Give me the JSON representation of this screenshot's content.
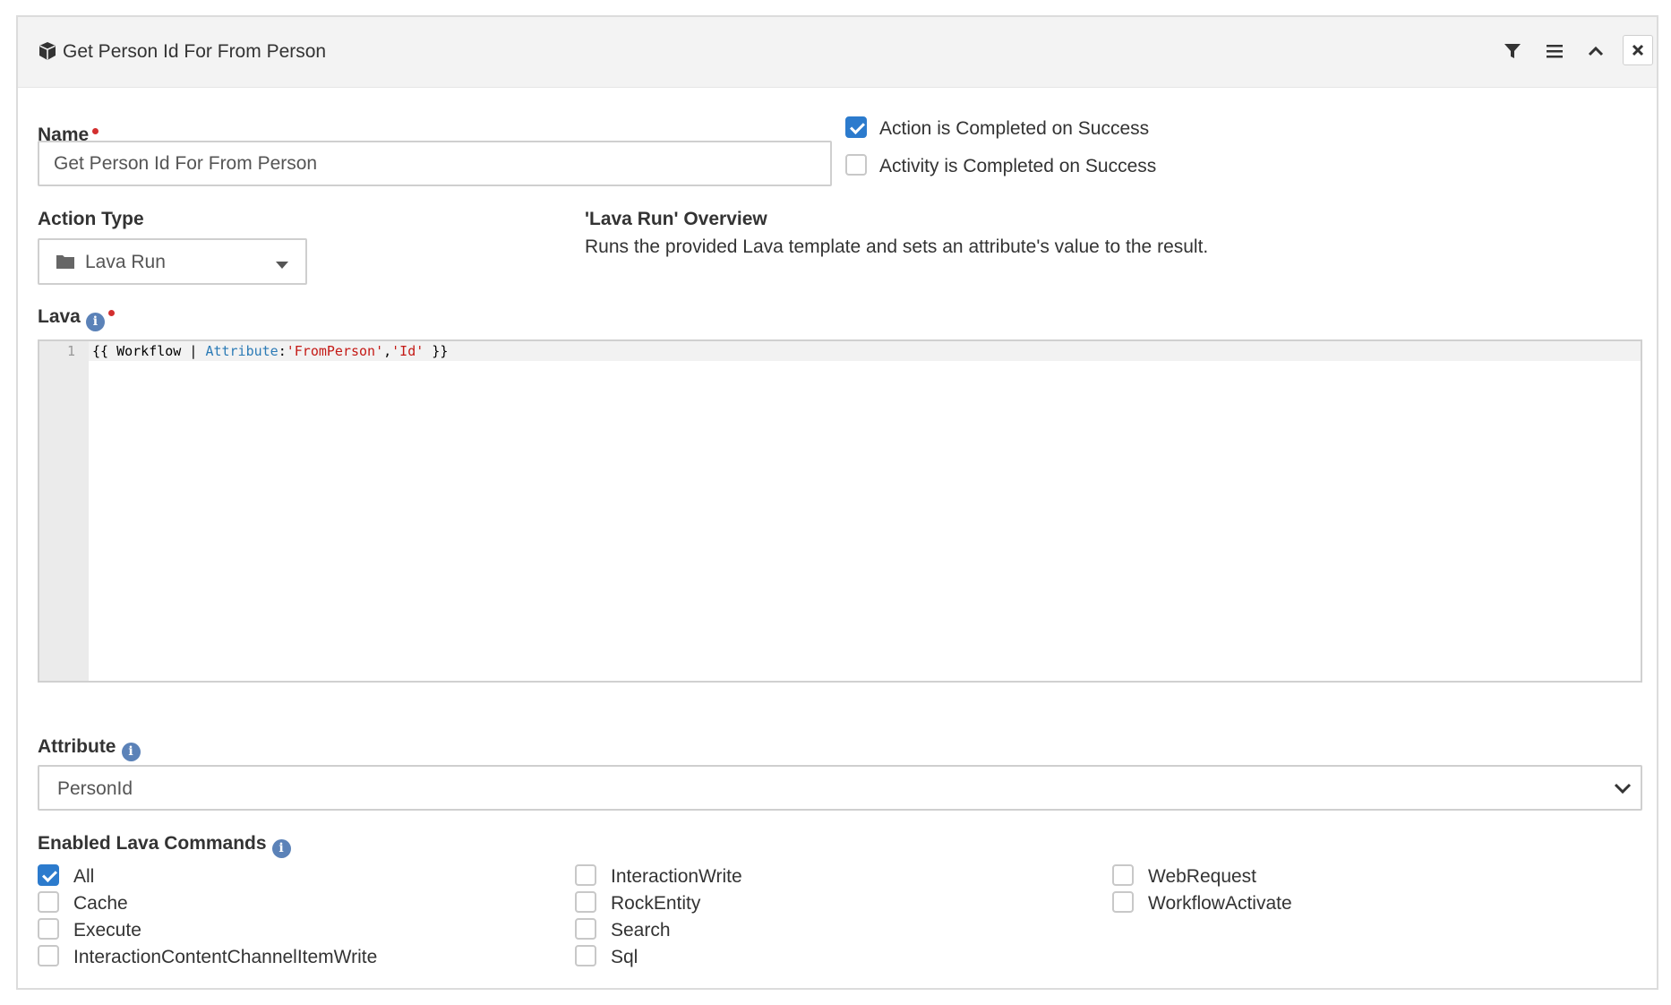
{
  "panel": {
    "title": "Get Person Id For From Person",
    "icons": [
      "cube-icon",
      "filter-icon",
      "menu-icon",
      "chevron-up-icon",
      "close-icon"
    ]
  },
  "name": {
    "label": "Name",
    "value": "Get Person Id For From Person"
  },
  "completion": {
    "action_label": "Action is Completed on Success",
    "action_checked": true,
    "activity_label": "Activity is Completed on Success",
    "activity_checked": false
  },
  "action_type": {
    "label": "Action Type",
    "value": "Lava Run"
  },
  "overview": {
    "title": "'Lava Run' Overview",
    "description": "Runs the provided Lava template and sets an attribute's value to the result."
  },
  "lava": {
    "label": "Lava",
    "line_number": "1",
    "code": {
      "t1": "{{ Workflow | ",
      "t2": "Attribute",
      "t3": ":",
      "t4": "'FromPerson'",
      "t5": ",",
      "t6": "'Id'",
      "t7": " }}"
    }
  },
  "attribute": {
    "label": "Attribute",
    "value": "PersonId"
  },
  "commands": {
    "label": "Enabled Lava Commands",
    "items": [
      {
        "label": "All",
        "checked": true
      },
      {
        "label": "Cache",
        "checked": false
      },
      {
        "label": "Execute",
        "checked": false
      },
      {
        "label": "InteractionContentChannelItemWrite",
        "checked": false
      },
      {
        "label": "InteractionWrite",
        "checked": false
      },
      {
        "label": "RockEntity",
        "checked": false
      },
      {
        "label": "Search",
        "checked": false
      },
      {
        "label": "Sql",
        "checked": false
      },
      {
        "label": "WebRequest",
        "checked": false
      },
      {
        "label": "WorkflowActivate",
        "checked": false
      }
    ]
  },
  "colors": {
    "accent": "#2c7bcd",
    "required": "#d32f2f",
    "info": "#5b82b8",
    "header_bg": "#f3f3f3"
  }
}
